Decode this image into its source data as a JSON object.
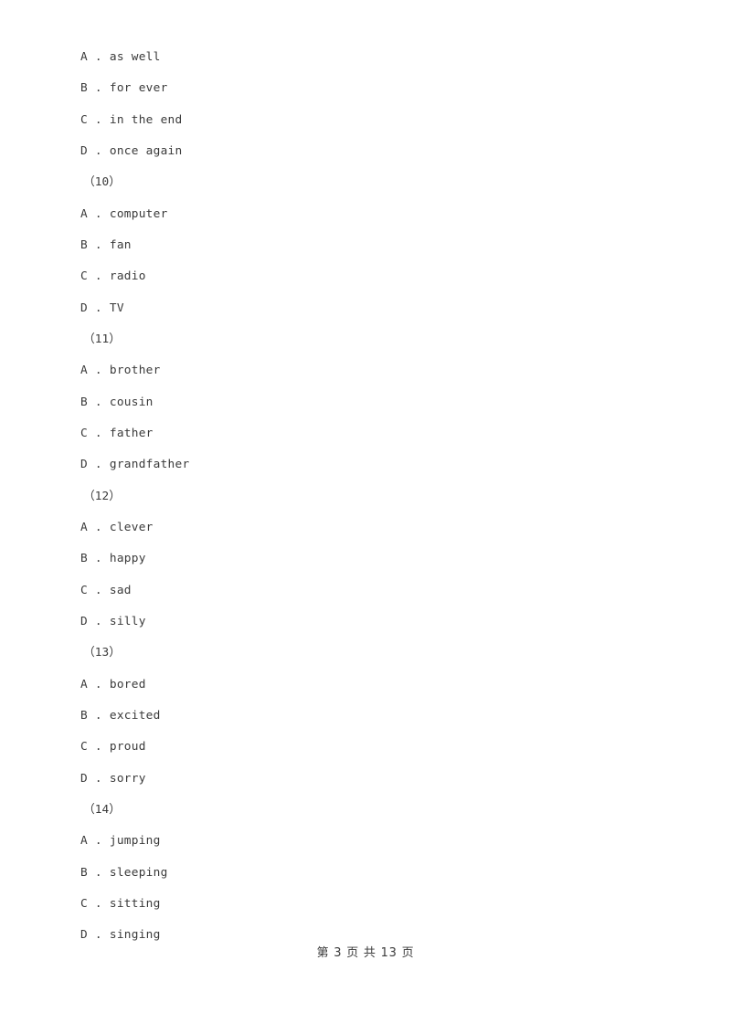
{
  "document": {
    "page_background": "#ffffff",
    "text_color": "#3a3a3a"
  },
  "blocks": [
    {
      "options": [
        {
          "letter": "A",
          "sep": " . ",
          "text": "as well"
        },
        {
          "letter": "B",
          "sep": " . ",
          "text": "for ever"
        },
        {
          "letter": "C",
          "sep": " . ",
          "text": "in the end"
        },
        {
          "letter": "D",
          "sep": " . ",
          "text": "once again"
        }
      ],
      "question_number": "（10）"
    },
    {
      "options": [
        {
          "letter": "A",
          "sep": " . ",
          "text": "computer"
        },
        {
          "letter": "B",
          "sep": " . ",
          "text": "fan"
        },
        {
          "letter": "C",
          "sep": " . ",
          "text": "radio"
        },
        {
          "letter": "D",
          "sep": " . ",
          "text": "TV"
        }
      ],
      "question_number": "（11）"
    },
    {
      "options": [
        {
          "letter": "A",
          "sep": " . ",
          "text": "brother"
        },
        {
          "letter": "B",
          "sep": " . ",
          "text": "cousin"
        },
        {
          "letter": "C",
          "sep": " . ",
          "text": "father"
        },
        {
          "letter": "D",
          "sep": " . ",
          "text": "grandfather"
        }
      ],
      "question_number": "（12）"
    },
    {
      "options": [
        {
          "letter": "A",
          "sep": " . ",
          "text": "clever"
        },
        {
          "letter": "B",
          "sep": " . ",
          "text": "happy"
        },
        {
          "letter": "C",
          "sep": " . ",
          "text": "sad"
        },
        {
          "letter": "D",
          "sep": " . ",
          "text": "silly"
        }
      ],
      "question_number": "（13）"
    },
    {
      "options": [
        {
          "letter": "A",
          "sep": " . ",
          "text": "bored"
        },
        {
          "letter": "B",
          "sep": " . ",
          "text": "excited"
        },
        {
          "letter": "C",
          "sep": " . ",
          "text": "proud"
        },
        {
          "letter": "D",
          "sep": " . ",
          "text": "sorry"
        }
      ],
      "question_number": "（14）"
    },
    {
      "options": [
        {
          "letter": "A",
          "sep": " . ",
          "text": "jumping"
        },
        {
          "letter": "B",
          "sep": " . ",
          "text": "sleeping"
        },
        {
          "letter": "C",
          "sep": " . ",
          "text": "sitting"
        },
        {
          "letter": "D",
          "sep": " . ",
          "text": "singing"
        }
      ],
      "question_number": null
    }
  ],
  "footer": {
    "text": "第 3 页 共 13 页",
    "current_page": "3",
    "total_pages": "13"
  }
}
